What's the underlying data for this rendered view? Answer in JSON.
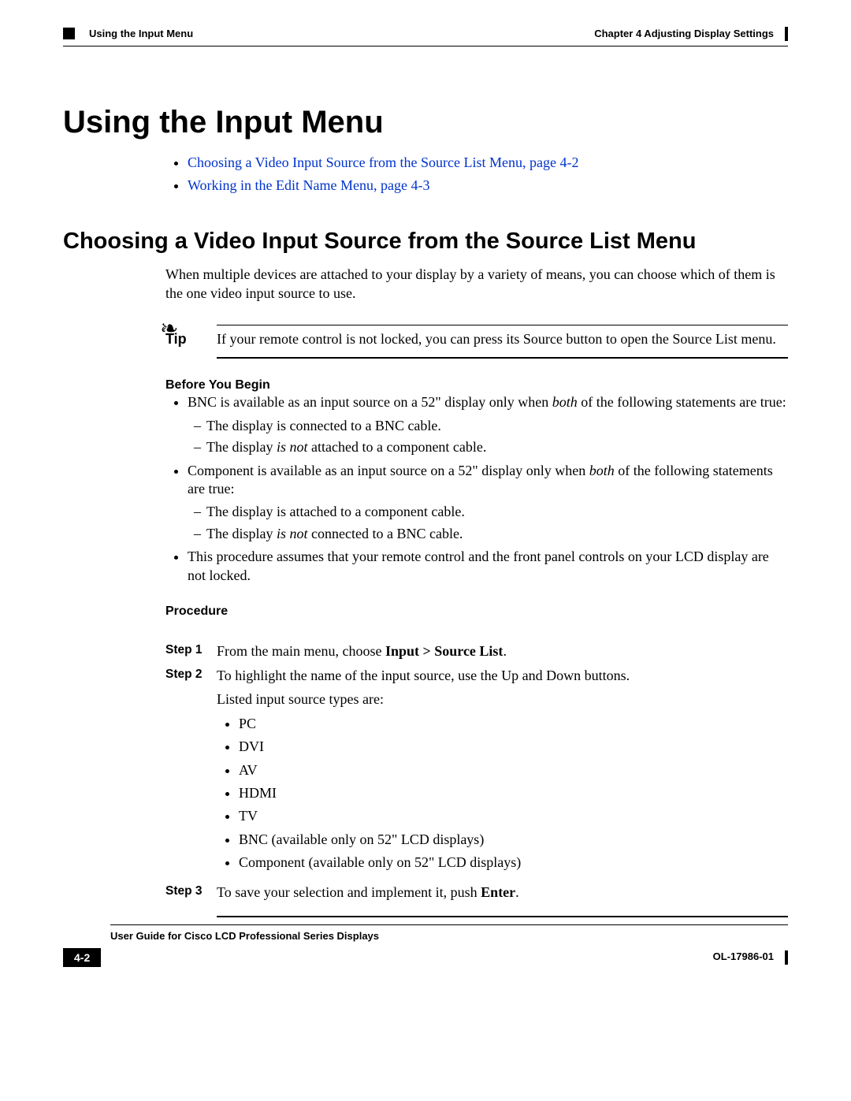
{
  "header": {
    "section_label": "Using the Input Menu",
    "chapter_label": "Chapter 4      Adjusting Display Settings"
  },
  "h1": "Using the Input Menu",
  "top_links": {
    "link1": "Choosing a Video Input Source from the Source List Menu, page 4-2",
    "link2": "Working in the Edit Name Menu, page 4-3"
  },
  "h2": "Choosing a Video Input Source from the Source List Menu",
  "intro": "When multiple devices are attached to your display by a variety of means, you can choose which of them is the one video input source to use.",
  "tip": {
    "label": "Tip",
    "text": "If your remote control is not locked, you can press its Source button to open the Source List menu."
  },
  "before": {
    "heading": "Before You Begin",
    "bnc_intro_a": "BNC is available as an input source on a 52\" display only when ",
    "both_word": "both",
    "bnc_intro_b": " of the following statements are true:",
    "bnc_sub1": "The display is connected to a BNC cable.",
    "bnc_sub2_a": "The display ",
    "isnot": "is not",
    "bnc_sub2_b": " attached to a component cable.",
    "comp_intro_a": "Component is available as an input source on a 52\" display only when ",
    "comp_intro_b": " of the following statements are true:",
    "comp_sub1": "The display is attached to a component cable.",
    "comp_sub2_a": "The display ",
    "comp_sub2_b": " connected to a BNC cable.",
    "assume": "This procedure assumes that your remote control and the front panel controls on your LCD display are not locked."
  },
  "procedure": {
    "heading": "Procedure",
    "step1_label": "Step 1",
    "step1_a": "From the main menu, choose ",
    "step1_b": "Input > Source List",
    "step1_c": ".",
    "step2_label": "Step 2",
    "step2_a": "To highlight the name of the input source, use the Up and Down buttons.",
    "step2_b": "Listed input source types are:",
    "sources": {
      "s1": "PC",
      "s2": "DVI",
      "s3": "AV",
      "s4": "HDMI",
      "s5": "TV",
      "s6": "BNC (available only on 52\" LCD displays)",
      "s7": "Component (available only on 52\" LCD displays)"
    },
    "step3_label": "Step 3",
    "step3_a": "To save your selection and implement it, push ",
    "step3_b": "Enter",
    "step3_c": "."
  },
  "footer": {
    "guide": "User Guide for Cisco LCD Professional Series Displays",
    "pagenum": "4-2",
    "docnum": "OL-17986-01"
  }
}
